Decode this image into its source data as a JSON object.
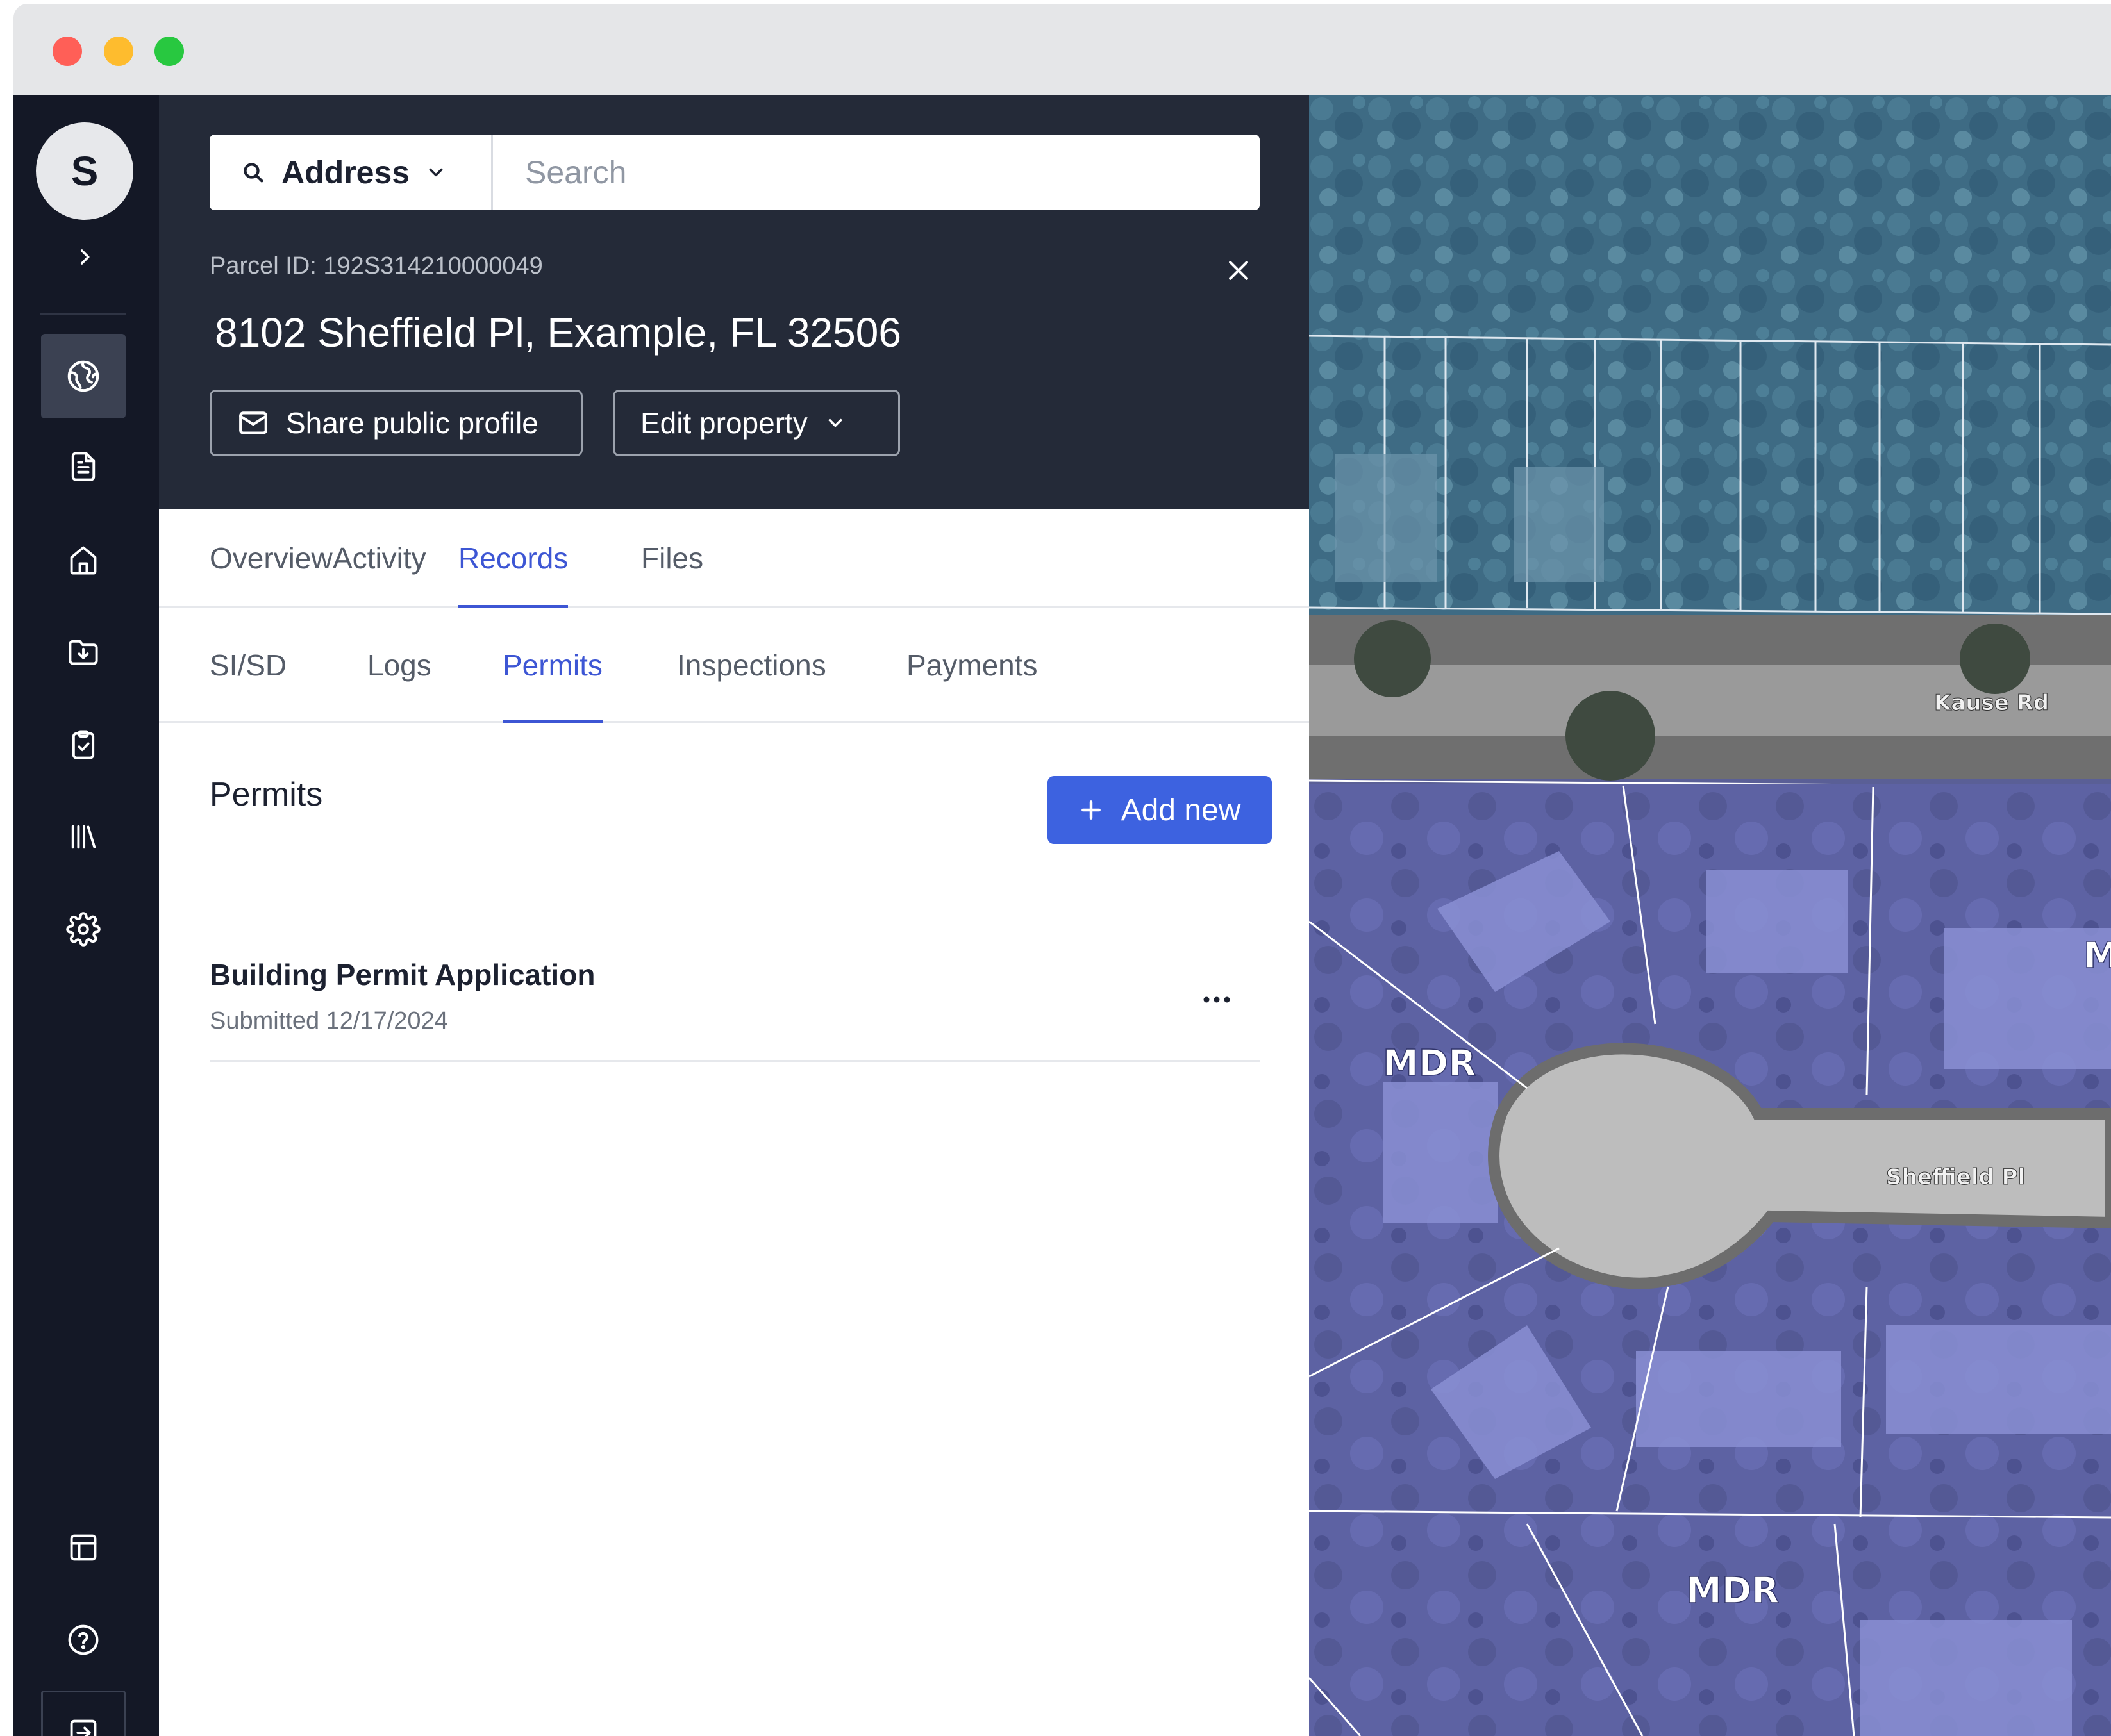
{
  "user": {
    "avatar_initial": "S"
  },
  "search": {
    "type_label": "Address",
    "placeholder": "Search"
  },
  "property": {
    "parcel_id": "Parcel ID: 192S314210000049",
    "address": "8102 Sheffield Pl, Example, FL 32506"
  },
  "actions": {
    "share_label": "Share public profile",
    "edit_label": "Edit property"
  },
  "tabs": [
    {
      "label": "Overview",
      "active": false
    },
    {
      "label": "Activity",
      "active": false
    },
    {
      "label": "Records",
      "active": true
    },
    {
      "label": "Files",
      "active": false
    }
  ],
  "subtabs": [
    {
      "label": "SI/SD",
      "active": false
    },
    {
      "label": "Logs",
      "active": false
    },
    {
      "label": "Permits",
      "active": true
    },
    {
      "label": "Inspections",
      "active": false
    },
    {
      "label": "Payments",
      "active": false
    }
  ],
  "permits": {
    "section_title": "Permits",
    "add_label": "Add new",
    "items": [
      {
        "title": "Building Permit Application",
        "submitted": "Submitted 12/17/2024"
      }
    ]
  },
  "sidebar": {
    "top_icons": [
      "globe-icon",
      "document-icon",
      "home-icon",
      "folder-download-icon",
      "clipboard-check-icon",
      "library-icon",
      "gear-icon"
    ],
    "bottom_icons": [
      "layout-icon",
      "help-icon",
      "logout-icon"
    ],
    "active_icon": "globe-icon"
  },
  "map": {
    "street_labels": [
      "Kause Rd",
      "Sheffield Pl"
    ],
    "zone_labels": [
      "MDR",
      "MDR",
      "M"
    ],
    "zone_color": "#6a6fc0",
    "parcel_tint": "#3e6b84"
  },
  "colors": {
    "accent": "#3d56d4",
    "primary_button": "#3d62e0",
    "rail": "#141826",
    "header": "#242a38"
  }
}
